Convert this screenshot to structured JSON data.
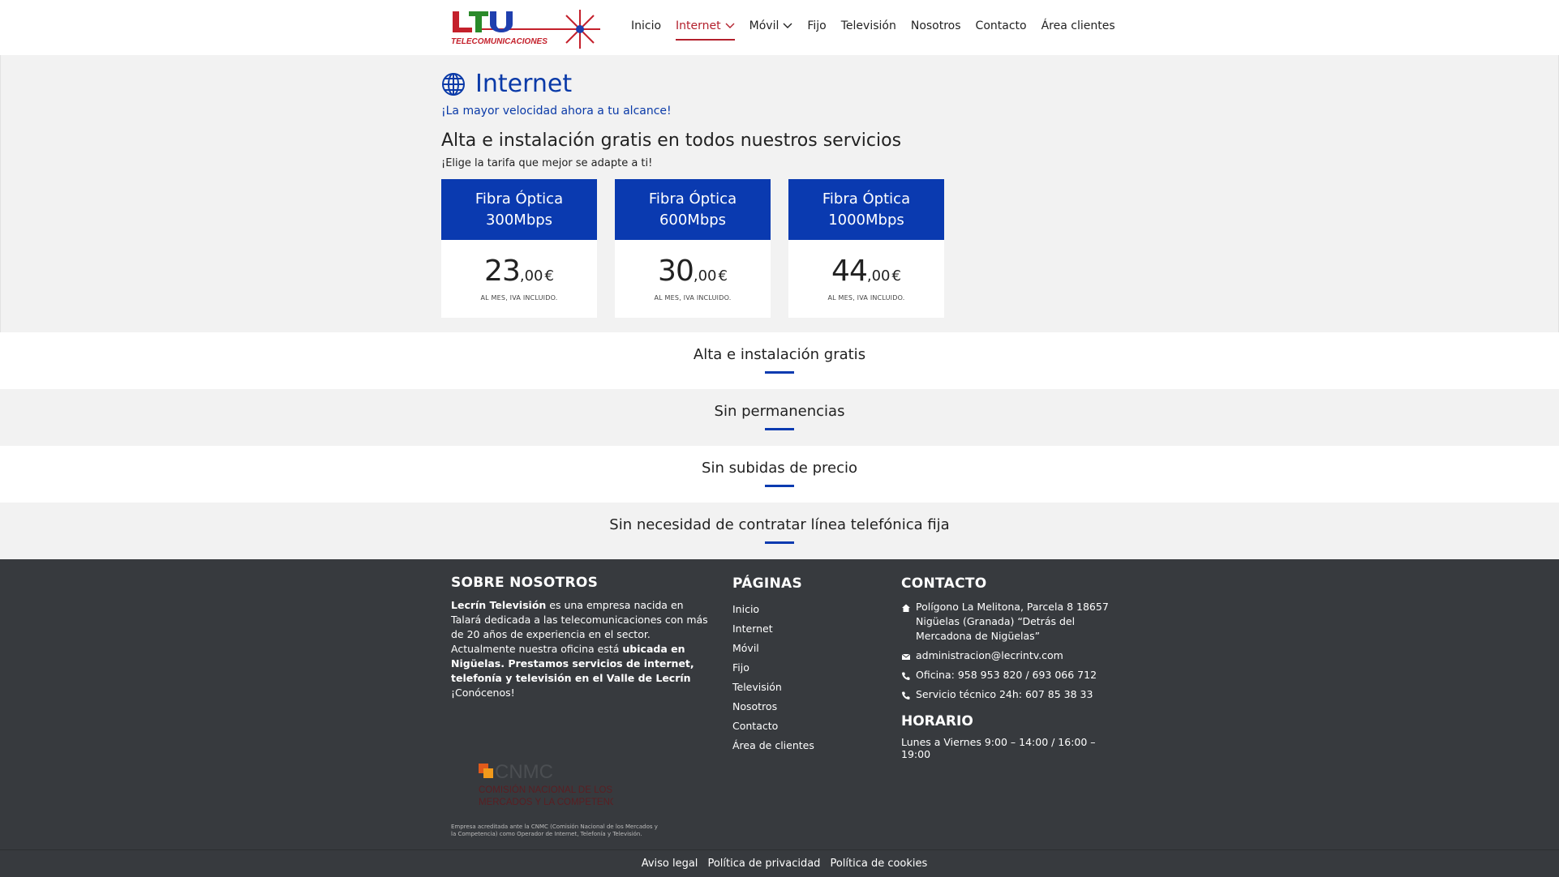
{
  "header": {
    "logo_text": "LTV",
    "logo_sub": "TELECOMUNICACIONES",
    "nav": [
      {
        "label": "Inicio",
        "active": false,
        "has_dropdown": false
      },
      {
        "label": "Internet",
        "active": true,
        "has_dropdown": true
      },
      {
        "label": "Móvil",
        "active": false,
        "has_dropdown": true
      },
      {
        "label": "Fijo",
        "active": false,
        "has_dropdown": false
      },
      {
        "label": "Televisión",
        "active": false,
        "has_dropdown": false
      },
      {
        "label": "Nosotros",
        "active": false,
        "has_dropdown": false
      },
      {
        "label": "Contacto",
        "active": false,
        "has_dropdown": false
      },
      {
        "label": "Área clientes",
        "active": false,
        "has_dropdown": false
      }
    ]
  },
  "hero": {
    "icon": "globe-icon",
    "title": "Internet",
    "subtitle": "¡La mayor velocidad ahora a tu alcance!",
    "promo_title": "Alta e instalación gratis en todos nuestros servicios",
    "promo_sub": "¡Elige la tarifa que mejor se adapte a ti!"
  },
  "plans": [
    {
      "name_line1": "Fibra Óptica",
      "name_line2": "300Mbps",
      "price_int": "23",
      "price_dec": ",00",
      "currency": "€",
      "note": "AL MES, IVA INCLUIDO."
    },
    {
      "name_line1": "Fibra Óptica",
      "name_line2": "600Mbps",
      "price_int": "30",
      "price_dec": ",00",
      "currency": "€",
      "note": "AL MES, IVA INCLUIDO."
    },
    {
      "name_line1": "Fibra Óptica",
      "name_line2": "1000Mbps",
      "price_int": "44",
      "price_dec": ",00",
      "currency": "€",
      "note": "AL MES, IVA INCLUIDO."
    }
  ],
  "features": [
    "Alta e instalación gratis",
    "Sin permanencias",
    "Sin subidas de precio",
    "Sin necesidad de contratar línea telefónica fija"
  ],
  "footer": {
    "about": {
      "heading": "SOBRE NOSOTROS",
      "p1_bold": "Lecrín Televisión",
      "p1": " es una empresa nacida en Talará dedicada a las telecomunicaciones con más de 20 años de experiencia en el sector. Actualmente nuestra oficina está ",
      "p2_bold": "ubicada en Nigüelas. Prestamos servicios de internet, telefonía y televisión en el Valle de Lecrín",
      "p3": " ¡Conócenos!"
    },
    "pages": {
      "heading": "PÁGINAS",
      "links": [
        "Inicio",
        "Internet",
        "Móvil",
        "Fijo",
        "Televisión",
        "Nosotros",
        "Contacto",
        "Área de clientes"
      ]
    },
    "contact": {
      "heading": "CONTACTO",
      "address": "Polígono La Melitona, Parcela 8 18657 Nigüelas (Granada) “Detrás del Mercadona de Nigüelas”",
      "email": "administracion@lecrintv.com",
      "phone_office": "Oficina: 958 953 820 / 693 066 712",
      "phone_support": "Servicio técnico 24h: 607 85 38 33"
    },
    "schedule": {
      "heading": "HORARIO",
      "hours": "Lunes a Viernes 9:00 – 14:00 / 16:00 – 19:00"
    },
    "cnmc": {
      "logo_text": "CNMC",
      "logo_line1": "COMISIÓN NACIONAL DE LOS",
      "logo_line2": "MERCADOS Y LA COMPETENCIA",
      "note": "Empresa acreditada ante la CNMC (Comisión Nacional de los Mercados y la Competencia) como Operador de Internet, Telefonía y Televisión."
    },
    "bottom_links": [
      "Aviso legal",
      "Política de privacidad",
      "Política de cookies"
    ]
  },
  "colors": {
    "brand_blue": "#0a3ab0",
    "brand_red": "#b3202c",
    "footer_bg": "#373a3e"
  }
}
